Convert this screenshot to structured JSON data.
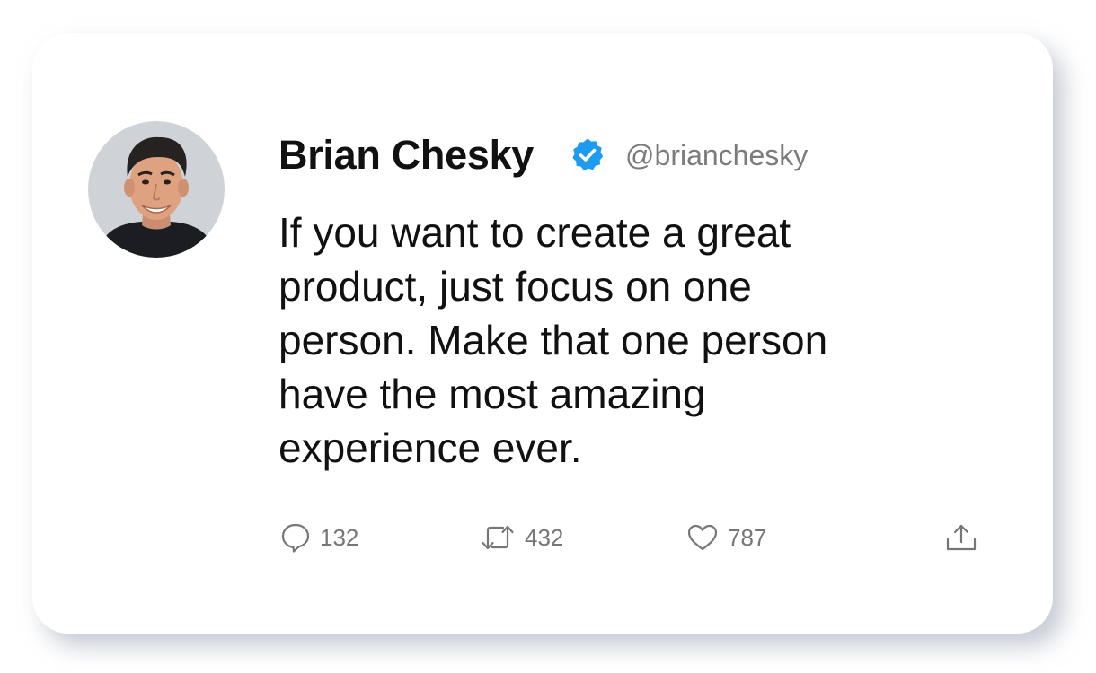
{
  "tweet": {
    "author_name": "Brian Chesky",
    "handle": "@brianchesky",
    "text": "If you want to create a great\nproduct, just focus on one\nperson. Make that one person\nhave the most amazing\nexperience ever.",
    "verified_icon": "verified-badge-icon",
    "verified_color": "#1d9bf0"
  },
  "actions": {
    "replies": {
      "icon": "reply-icon",
      "count": "132"
    },
    "retweets": {
      "icon": "retweet-icon",
      "count": "432"
    },
    "likes": {
      "icon": "like-icon",
      "count": "787"
    },
    "share": {
      "icon": "share-icon"
    }
  }
}
